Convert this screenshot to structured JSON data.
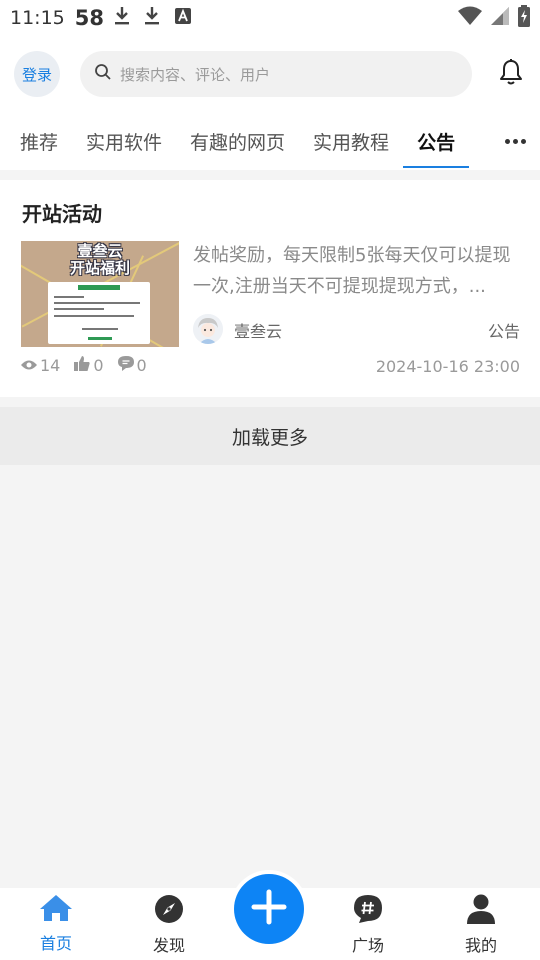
{
  "status_bar": {
    "time": "11:15",
    "badge": "58",
    "icons": [
      "download-icon",
      "download-icon",
      "a-box-icon",
      "wifi-icon",
      "signal-icon",
      "battery-icon"
    ]
  },
  "header": {
    "login_label": "登录",
    "search_placeholder": "搜索内容、评论、用户",
    "bell_icon": "bell-icon"
  },
  "tabs": {
    "items": [
      {
        "label": "推荐"
      },
      {
        "label": "实用软件"
      },
      {
        "label": "有趣的网页"
      },
      {
        "label": "实用教程"
      },
      {
        "label": "公告"
      }
    ],
    "active_index": 4,
    "more_icon": "more-dots-icon"
  },
  "post": {
    "title": "开站活动",
    "thumbnail_text": "壹叁云\n开站福利",
    "excerpt": "发帖奖励，每天限制5张每天仅可以提现一次,注册当天不可提现提现方式，...",
    "author": "壹叁云",
    "category": "公告",
    "views": "14",
    "likes": "0",
    "comments": "0",
    "date": "2024-10-16 23:00"
  },
  "load_more_label": "加载更多",
  "bottom_nav": {
    "items": [
      {
        "label": "首页",
        "icon": "home-icon",
        "active": true
      },
      {
        "label": "发现",
        "icon": "compass-icon",
        "active": false
      },
      {
        "label": "广场",
        "icon": "hashtag-chat-icon",
        "active": false
      },
      {
        "label": "我的",
        "icon": "user-icon",
        "active": false
      }
    ],
    "fab_icon": "plus-icon"
  },
  "colors": {
    "accent": "#1a7fe0",
    "fab": "#0d84f5"
  }
}
